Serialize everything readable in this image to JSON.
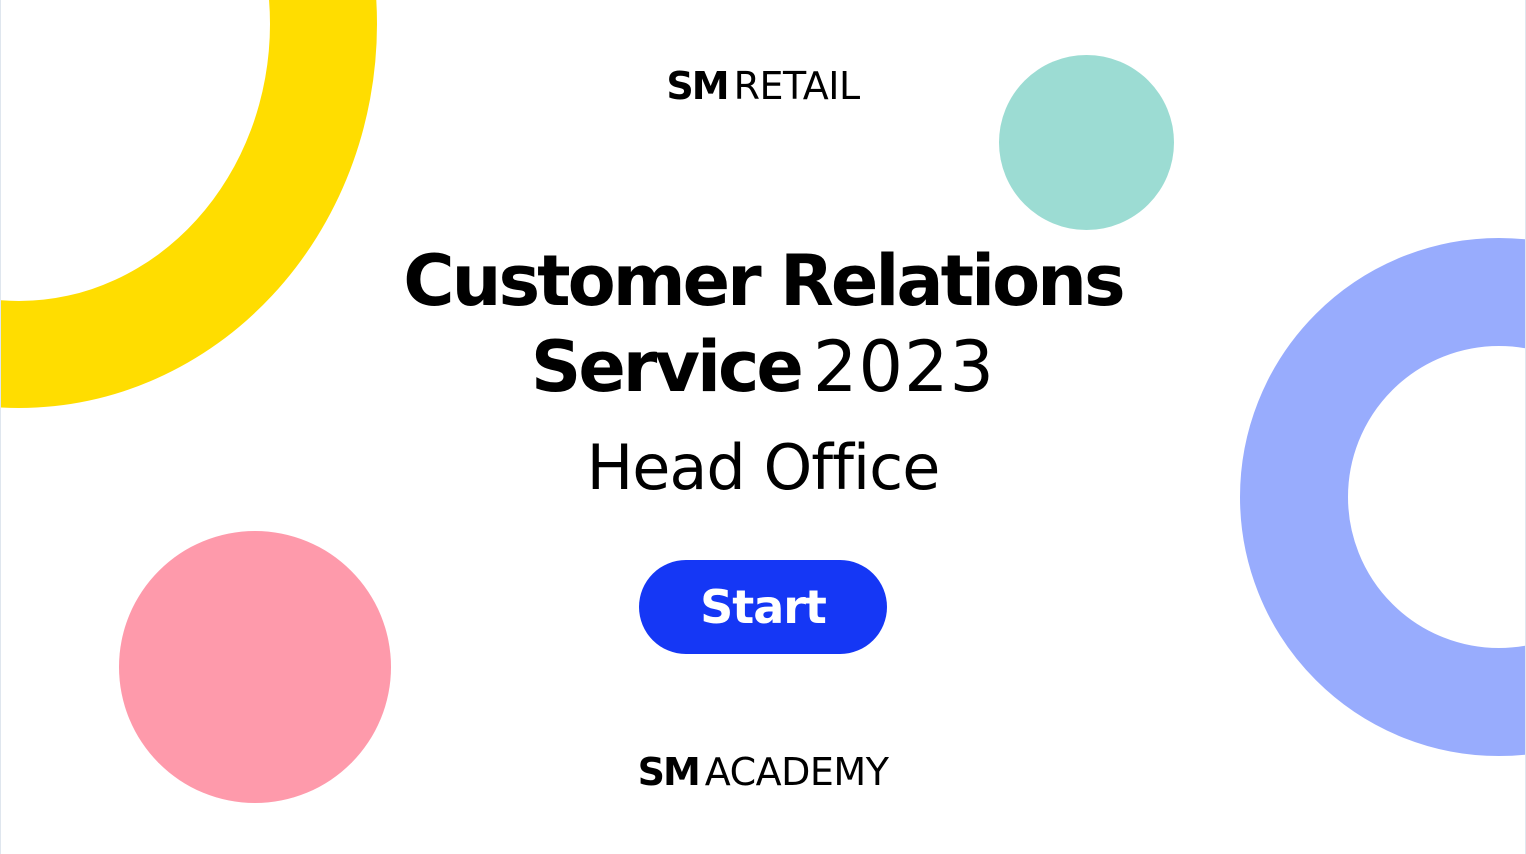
{
  "brand_top": {
    "bold": "SM",
    "light": "RETAIL"
  },
  "title": {
    "line1": "Customer Relations",
    "line2_bold": "Service",
    "line2_year": "2023"
  },
  "subtitle": "Head Office",
  "start_button_label": "Start",
  "brand_bottom": {
    "bold": "SM",
    "light": "ACADEMY"
  },
  "colors": {
    "accent_button": "#1537f5",
    "yellow_ring": "#ffdd00",
    "teal_circle": "#9cdcd3",
    "pink_circle": "#fe9aab",
    "lavender_ring": "#98acfd"
  }
}
